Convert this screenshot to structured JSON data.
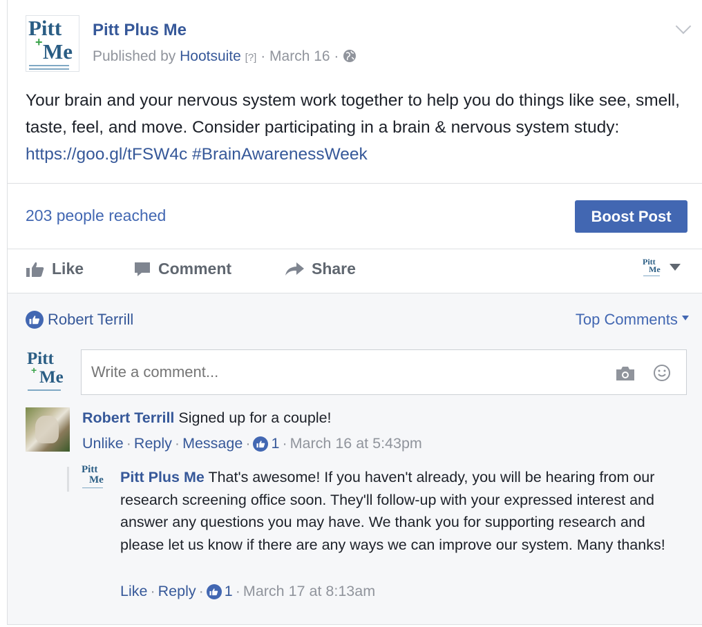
{
  "post": {
    "page_name": "Pitt Plus Me",
    "published_by_prefix": "Published by",
    "publisher": "Hootsuite",
    "help_mark": "[?]",
    "sep": "·",
    "date": "March 16",
    "text_main": "Your brain and your nervous system work together to help you do things like see, smell, taste, feel, and move. Consider participating in a brain & nervous system study:",
    "link": "https://goo.gl/tFSW4c",
    "hashtag": "#BrainAwarenessWeek"
  },
  "logo": {
    "pitt": "Pitt",
    "me": "Me",
    "plus": "+"
  },
  "stats": {
    "reach": "203 people reached",
    "boost_label": "Boost Post"
  },
  "actions": {
    "like": "Like",
    "comment": "Comment",
    "share": "Share"
  },
  "comments": {
    "liker": "Robert Terrill",
    "sort": "Top Comments",
    "input_placeholder": "Write a comment...",
    "items": [
      {
        "author": "Robert Terrill",
        "text": "Signed up for a couple!",
        "action1": "Unlike",
        "action2": "Reply",
        "action3": "Message",
        "likes": "1",
        "time": "March 16 at 5:43pm"
      },
      {
        "author": "Pitt Plus Me",
        "text": "That's awesome! If you haven't already, you will be hearing from our research screening office soon. They'll follow-up with your expressed interest and answer any questions you may have. We thank you for supporting research and please let us know if there are any ways we can improve our system. Many thanks!",
        "action1": "Like",
        "action2": "Reply",
        "likes": "1",
        "time": "March 17 at 8:13am"
      }
    ]
  },
  "colors": {
    "link": "#365899",
    "accent": "#4267b2",
    "meta_grey": "#90949c",
    "panel": "#f6f7f9"
  },
  "icons": [
    "globe-icon",
    "chevron-down-icon",
    "thumbs-up-icon",
    "comment-icon",
    "share-icon",
    "camera-icon",
    "smiley-icon",
    "caret-down-icon"
  ]
}
